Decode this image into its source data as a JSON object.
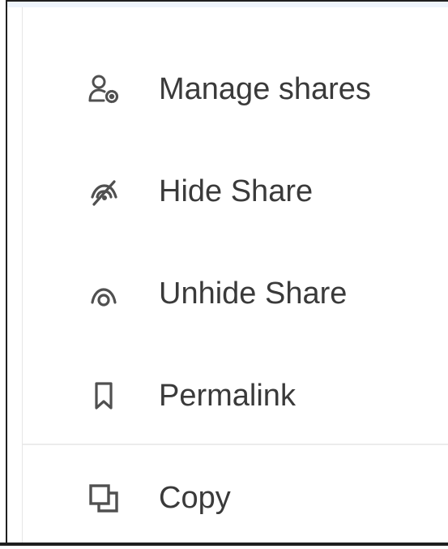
{
  "menu": {
    "items": [
      {
        "label": "Manage shares",
        "icon": "user-gear-icon"
      },
      {
        "label": "Hide Share",
        "icon": "eye-off-icon"
      },
      {
        "label": "Unhide Share",
        "icon": "eye-icon"
      },
      {
        "label": "Permalink",
        "icon": "bookmark-icon"
      },
      {
        "label": "Copy",
        "icon": "copy-icon"
      }
    ]
  },
  "colors": {
    "text": "#3a3a3a",
    "icon": "#505050",
    "separator": "#ececec",
    "top_strip": "#eef4fc"
  }
}
